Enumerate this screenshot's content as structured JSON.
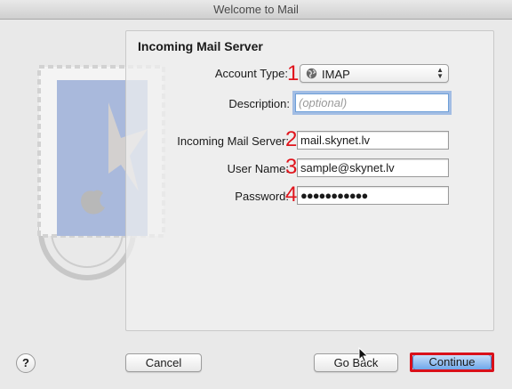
{
  "window": {
    "title": "Welcome to Mail"
  },
  "section": {
    "title": "Incoming Mail Server"
  },
  "form": {
    "account_type": {
      "label": "Account Type:",
      "value": "IMAP",
      "step": "1",
      "icon": "globe-icon"
    },
    "description": {
      "label": "Description:",
      "placeholder": "(optional)",
      "value": ""
    },
    "incoming_server": {
      "label": "Incoming Mail Server:",
      "value": "mail.skynet.lv",
      "step": "2"
    },
    "user_name": {
      "label": "User Name:",
      "value": "sample@skynet.lv",
      "step": "3"
    },
    "password": {
      "label": "Password:",
      "masked_value": "●●●●●●●●●●●",
      "step": "4"
    }
  },
  "buttons": {
    "help": "?",
    "cancel": "Cancel",
    "go_back": "Go Back",
    "continue": "Continue"
  },
  "colors": {
    "annotation_red": "#e0141c",
    "focus_blue": "#6e9fd8",
    "primary_button": "#6fa7ea"
  }
}
